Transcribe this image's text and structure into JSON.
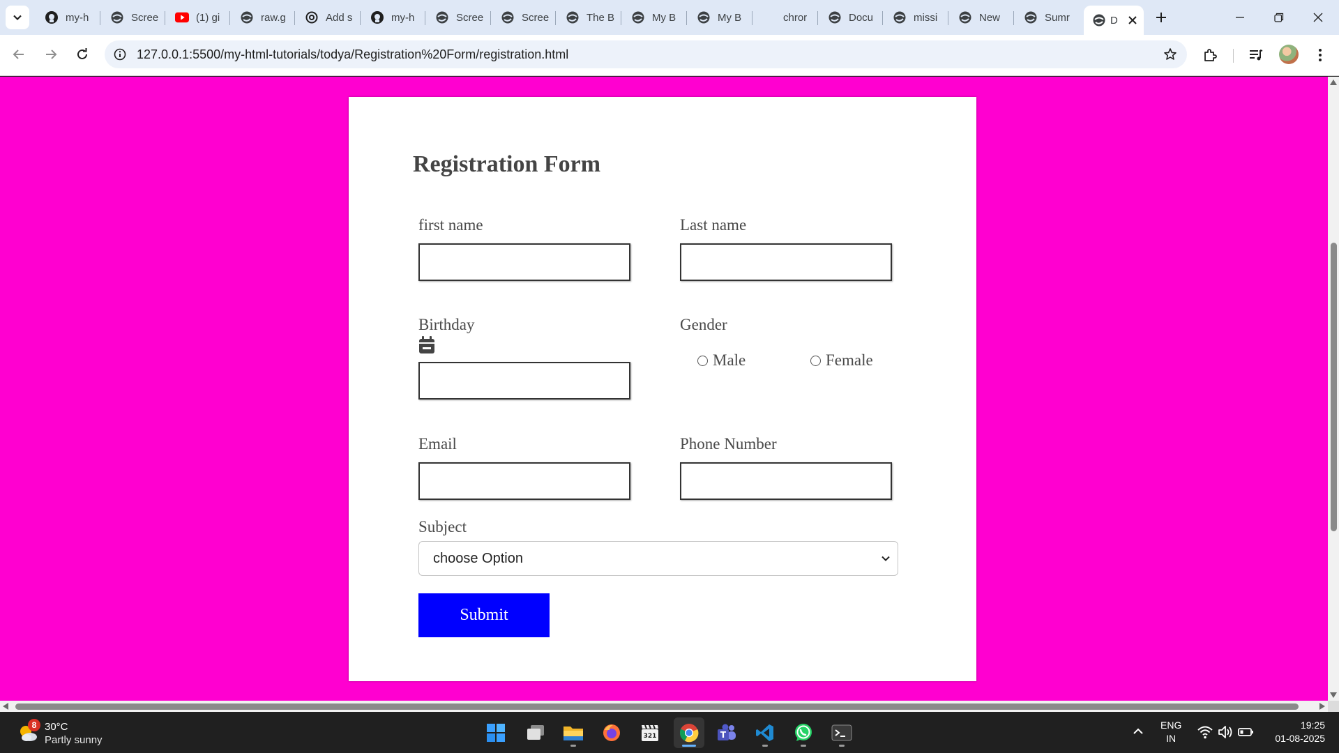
{
  "browser": {
    "tabs": [
      {
        "title": "my-h",
        "icon": "github-icon"
      },
      {
        "title": "Scree",
        "icon": "globe-icon"
      },
      {
        "title": "(1) gi",
        "icon": "youtube-icon"
      },
      {
        "title": "raw.g",
        "icon": "globe-icon"
      },
      {
        "title": "Add s",
        "icon": "openai-icon"
      },
      {
        "title": "my-h",
        "icon": "github-icon"
      },
      {
        "title": "Scree",
        "icon": "globe-icon"
      },
      {
        "title": "Scree",
        "icon": "globe-icon"
      },
      {
        "title": "The B",
        "icon": "globe-icon"
      },
      {
        "title": "My B",
        "icon": "globe-icon"
      },
      {
        "title": "My B",
        "icon": "globe-icon"
      },
      {
        "title": "chror",
        "icon": "none"
      },
      {
        "title": "Docu",
        "icon": "globe-icon"
      },
      {
        "title": "missi",
        "icon": "globe-icon"
      },
      {
        "title": "New",
        "icon": "globe-icon"
      },
      {
        "title": "Sumr",
        "icon": "globe-icon"
      },
      {
        "title": "D",
        "icon": "globe-icon",
        "active": true
      }
    ],
    "url": "127.0.0.1:5500/my-html-tutorials/todya/Registration%20Form/registration.html"
  },
  "form": {
    "title": "Registration Form",
    "first_name_label": "first name",
    "last_name_label": "Last name",
    "birthday_label": "Birthday",
    "gender_label": "Gender",
    "gender_options": [
      "Male",
      "Female"
    ],
    "email_label": "Email",
    "phone_label": "Phone Number",
    "subject_label": "Subject",
    "subject_selected": "choose Option",
    "submit_label": "Submit"
  },
  "colors": {
    "page_background": "#ff00d0",
    "submit_background": "#0000ff"
  },
  "taskbar": {
    "weather_badge": "8",
    "weather_temp": "30°C",
    "weather_condition": "Partly sunny",
    "language": "ENG",
    "region": "IN",
    "time": "19:25",
    "date": "01-08-2025"
  }
}
